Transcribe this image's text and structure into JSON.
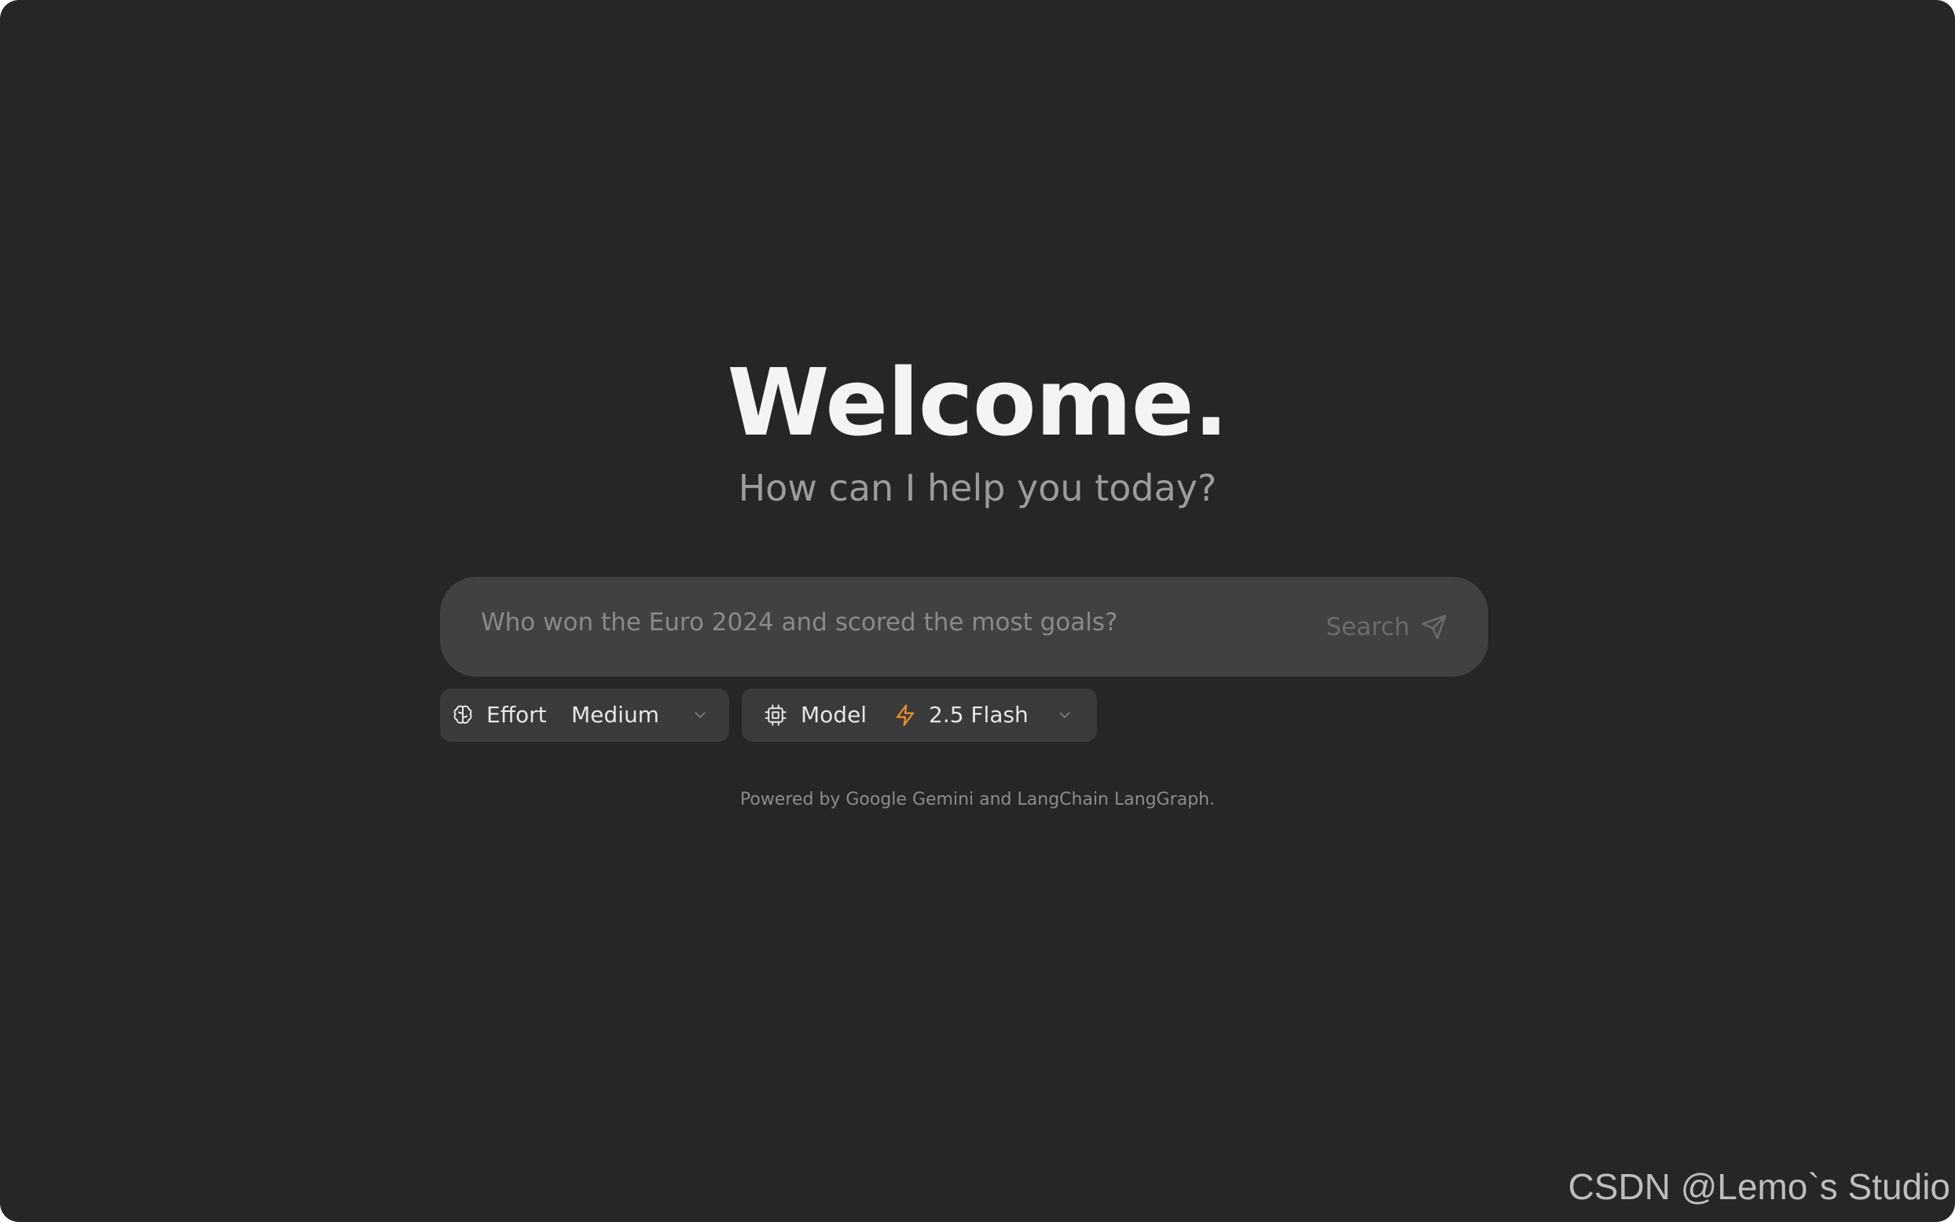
{
  "welcome": {
    "title": "Welcome.",
    "subtitle": "How can I help you today?"
  },
  "search": {
    "placeholder": "Who won the Euro 2024 and scored the most goals?",
    "value": "",
    "button_label": "Search",
    "button_icon": "send-icon"
  },
  "effort": {
    "icon": "brain-icon",
    "label": "Effort",
    "selected": "Medium"
  },
  "model": {
    "icon": "cpu-icon",
    "label": "Model",
    "selected_icon": "lightning-icon",
    "selected_icon_color": "#f28c28",
    "selected": "2.5 Flash"
  },
  "footer": {
    "text": "Powered by Google Gemini and LangChain LangGraph."
  },
  "watermark": {
    "text": "CSDN @Lemo`s Studio"
  },
  "colors": {
    "background": "#262626",
    "search_box": "#414141",
    "selector": "#3a3a3a",
    "accent": "#f28c28"
  }
}
